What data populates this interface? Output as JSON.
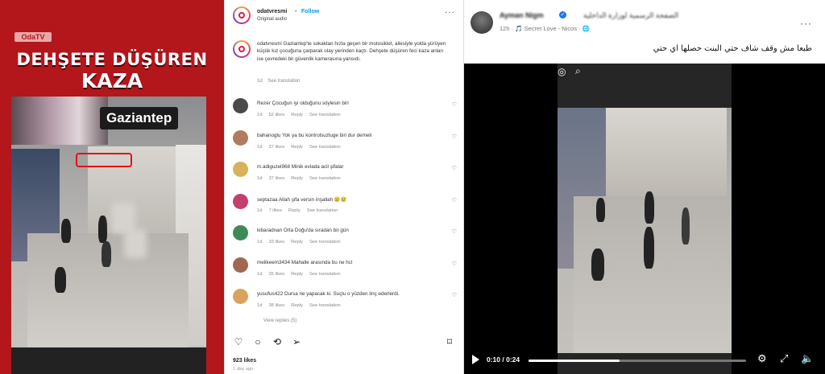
{
  "reel": {
    "logo": "OdaTV",
    "headline_line1": "DEHŞETE DÜŞÜREN",
    "headline_line2": "KAZA",
    "city_label": "Gaziantep"
  },
  "instagram": {
    "username": "odatvresmi",
    "separator": "•",
    "follow_label": "Follow",
    "audio": "Original audio",
    "caption": "odatvresmi Gaziantep'te sokaktan hızla geçen bir motosiklet, ailesiyle yolda yürüyen küçük kız çocuğuna çarparak olay yerinden kaçtı. Dehşete düşüren feci kaza anları ise çevredeki bir güvenlik kamerasına yansıdı.",
    "caption_age": "1d",
    "see_translation": "See translation",
    "reply_label": "Reply",
    "comments": [
      {
        "text": "Rezer Çocuğun iyi olduğunu söylesin biri",
        "age": "1d",
        "likes": "52 likes",
        "avatar_color": "#4a4a4a"
      },
      {
        "text": "bahanoglu Yok ya bu kontrolsuzluge biri dur demeli",
        "age": "1d",
        "likes": "37 likes",
        "avatar_color": "#b07c5e"
      },
      {
        "text": "m.adiguzel968 Minik evlada acil şifalar",
        "age": "1d",
        "likes": "37 likes",
        "avatar_color": "#d7b25a"
      },
      {
        "text": "septazaa Allah şifa versin inşallah 😢😢",
        "age": "1d",
        "likes": "7 likes",
        "avatar_color": "#c43f6d"
      },
      {
        "text": "kibaradnan Orta Doğu'da sıradan bir gün",
        "age": "1d",
        "likes": "33 likes",
        "avatar_color": "#3e8a57"
      },
      {
        "text": "melikeem3434 Mahalle arasında bu ne hız",
        "age": "1d",
        "likes": "35 likes",
        "avatar_color": "#a06850"
      },
      {
        "text": "yusufus422 Dursa ne yapacak ki. Suçlu o yüzden linç ederlerdi.",
        "age": "1d",
        "likes": "38 likes",
        "avatar_color": "#d9a35e"
      }
    ],
    "view_replies": "View replies (5)",
    "likes_total": "923 likes",
    "post_age": "1 day ago",
    "action_icons": [
      "heart-icon",
      "comment-icon",
      "repost-icon",
      "share-icon",
      "save-icon"
    ]
  },
  "facebook": {
    "author": "Ayman Nigm",
    "page_name": "الصفحة الرسمية لوزارة الداخلية",
    "meta": "12h · 🎵 Secret Love - Nicos · 🌐",
    "post_text": "طبعا مش وقف شاف حتي البنت حصلها اي حتي",
    "time_display": "0:10 / 0:24",
    "progress_fraction": 0.42,
    "more_label": "···",
    "brand_color": "#1877f2"
  }
}
